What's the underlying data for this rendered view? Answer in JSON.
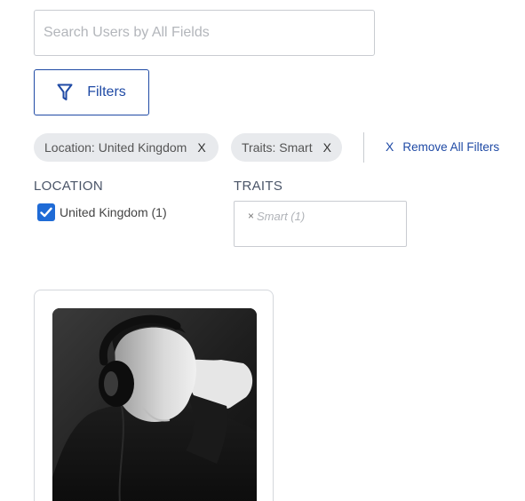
{
  "search": {
    "placeholder": "Search Users by All Fields",
    "value": ""
  },
  "filters_button": {
    "label": "Filters",
    "icon": "funnel-icon"
  },
  "active_filters": [
    {
      "label": "Location: United Kingdom",
      "remove": "X"
    },
    {
      "label": "Traits: Smart",
      "remove": "X"
    }
  ],
  "remove_all": {
    "icon": "X",
    "label": "Remove All Filters"
  },
  "location": {
    "title": "LOCATION",
    "options": [
      {
        "label": "United Kingdom (1)",
        "checked": true
      }
    ]
  },
  "traits": {
    "title": "TRAITS",
    "selected": [
      {
        "label": "Smart (1)",
        "remove": "×"
      }
    ]
  },
  "colors": {
    "accent": "#1f4aa5",
    "checkbox": "#1f6bd6",
    "chip_bg": "#e8eaed",
    "border": "#c9ccd1"
  }
}
